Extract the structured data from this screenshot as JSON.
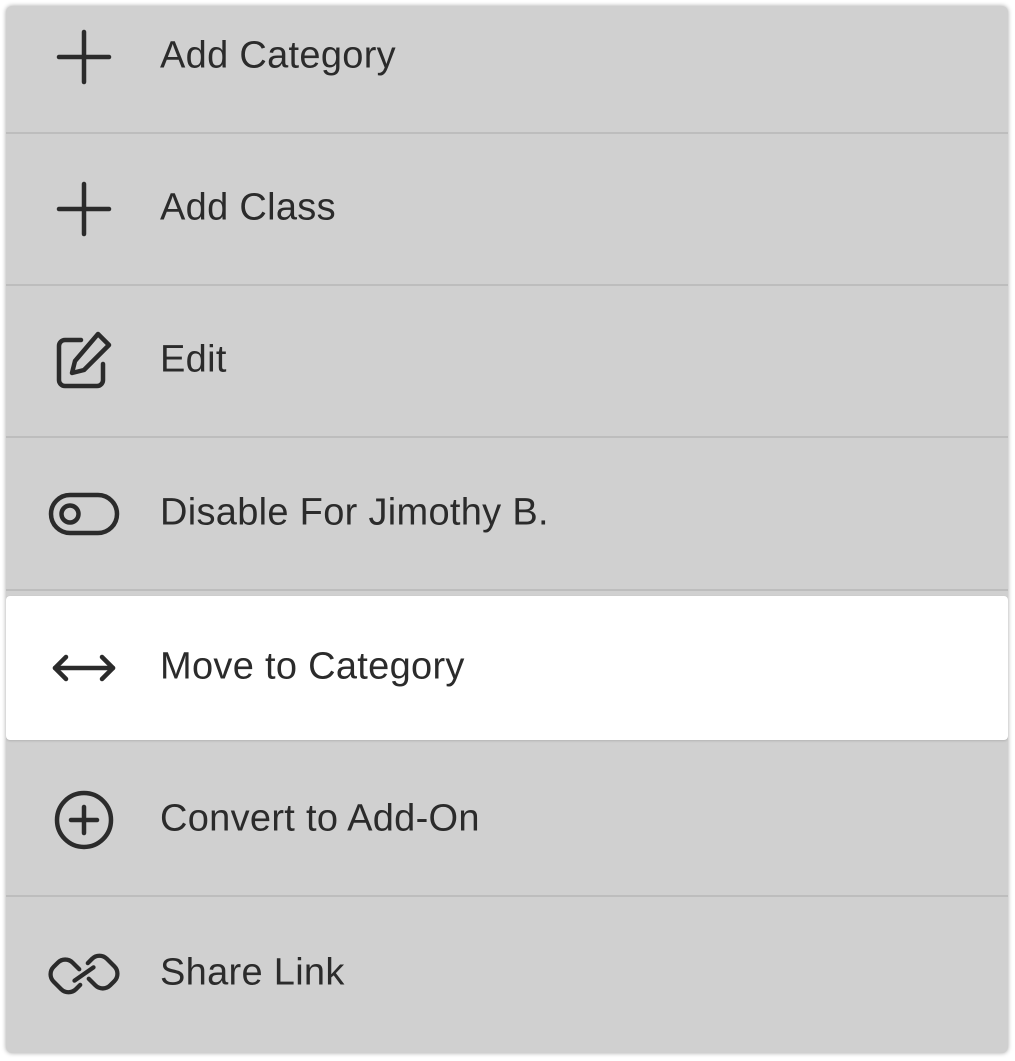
{
  "menu": {
    "items": [
      {
        "label": "Add Category",
        "icon": "plus-icon",
        "active": false
      },
      {
        "label": "Add Class",
        "icon": "plus-icon",
        "active": false
      },
      {
        "label": "Edit",
        "icon": "edit-icon",
        "active": false
      },
      {
        "label": "Disable For Jimothy B.",
        "icon": "toggle-icon",
        "active": false
      },
      {
        "label": "Move to Category",
        "icon": "move-arrows-icon",
        "active": true
      },
      {
        "label": "Convert to Add-On",
        "icon": "plus-circle-icon",
        "active": false
      },
      {
        "label": "Share Link",
        "icon": "link-icon",
        "active": false
      }
    ]
  },
  "colors": {
    "menu_background": "#d0d0d0",
    "active_background": "#ffffff",
    "divider": "#bdbdbd",
    "text": "#2b2b2b",
    "icon": "#2b2b2b"
  }
}
